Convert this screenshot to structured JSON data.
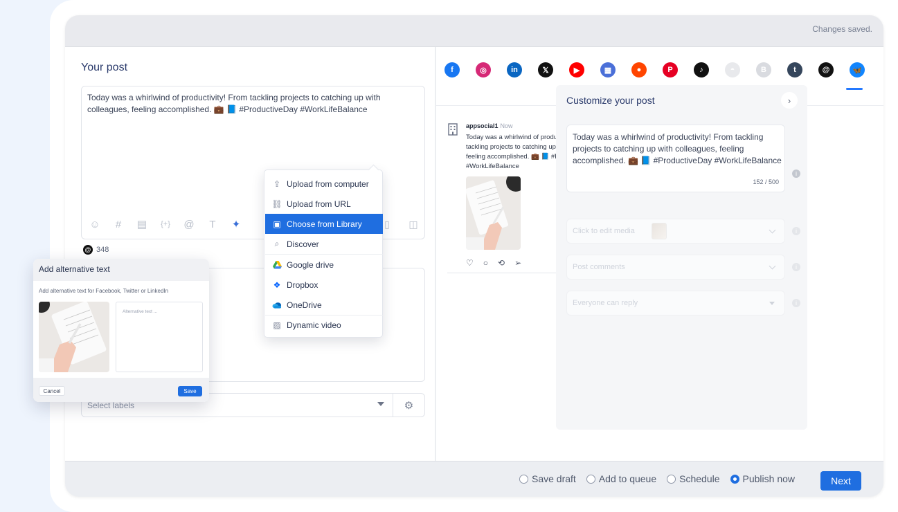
{
  "status": {
    "saved_text": "Changes saved."
  },
  "composer": {
    "title": "Your post",
    "text": "Today was a whirlwind of productivity! From tackling projects to catching up with colleagues, feeling accomplished. 💼 📘 #ProductiveDay #WorkLifeBalance",
    "char_count": "348",
    "labels_placeholder": "Select labels",
    "toolbar_icons": [
      "emoji-icon",
      "hashtag-icon",
      "list-icon",
      "variables-icon",
      "mention-icon",
      "text-format-icon",
      "magic-wand-icon",
      "file-icon",
      "gallery-icon"
    ]
  },
  "media_menu": {
    "items": [
      {
        "label": "Upload from computer",
        "icon": "upload-icon"
      },
      {
        "label": "Upload from URL",
        "icon": "link-icon"
      },
      {
        "label": "Choose from Library",
        "icon": "image-icon",
        "selected": true
      },
      {
        "label": "Discover",
        "icon": "search-icon"
      },
      {
        "label": "Google drive",
        "icon": "google-drive-icon"
      },
      {
        "label": "Dropbox",
        "icon": "dropbox-icon"
      },
      {
        "label": "OneDrive",
        "icon": "onedrive-icon"
      },
      {
        "label": "Dynamic video",
        "icon": "video-icon"
      }
    ]
  },
  "alt_modal": {
    "title": "Add alternative text",
    "subtitle": "Add alternative text for Facebook, Twitter or LinkedIn",
    "placeholder": "Alternative text ...",
    "cancel": "Cancel",
    "save": "Save"
  },
  "networks": [
    {
      "name": "facebook-icon",
      "color": "#1877f2",
      "glyph": "f"
    },
    {
      "name": "instagram-icon",
      "color": "#d62976",
      "glyph": "◎"
    },
    {
      "name": "linkedin-icon",
      "color": "#0a66c2",
      "glyph": "in"
    },
    {
      "name": "x-icon",
      "color": "#111111",
      "glyph": "𝕏"
    },
    {
      "name": "youtube-icon",
      "color": "#ff0000",
      "glyph": "▶"
    },
    {
      "name": "google-business-icon",
      "color": "#4a6fd8",
      "glyph": "▦"
    },
    {
      "name": "reddit-icon",
      "color": "#ff4500",
      "glyph": "●"
    },
    {
      "name": "pinterest-icon",
      "color": "#e60023",
      "glyph": "P"
    },
    {
      "name": "tiktok-icon",
      "color": "#111111",
      "glyph": "♪"
    },
    {
      "name": "snapchat-icon",
      "color": "#e8e9ec",
      "glyph": "◓"
    },
    {
      "name": "blogger-icon",
      "color": "#d9dbe0",
      "glyph": "B"
    },
    {
      "name": "tumblr-icon",
      "color": "#35465c",
      "glyph": "t"
    },
    {
      "name": "threads-icon",
      "color": "#111111",
      "glyph": "@"
    },
    {
      "name": "bluesky-icon",
      "color": "#1185fe",
      "glyph": "🦋"
    }
  ],
  "preview": {
    "account": "appsocial1",
    "time": "Now",
    "text": "Today was a whirlwind of productivity! From tackling projects to catching up with colleagues, feeling accomplished. 💼 📘 #ProductiveDay #WorkLifeBalance"
  },
  "customize": {
    "title": "Customize your post",
    "text": "Today was a whirlwind of productivity! From tackling projects to catching up with colleagues, feeling accomplished. 💼 📘 #ProductiveDay #WorkLifeBalance",
    "count": "152 / 500",
    "media_field": "Click to edit media",
    "comments_field": "Post comments",
    "reply_field": "Everyone can reply"
  },
  "footer": {
    "options": [
      "Save draft",
      "Add to queue",
      "Schedule",
      "Publish now"
    ],
    "selected_option": "Publish now",
    "next_label": "Next"
  },
  "colors": {
    "accent": "#1f6ee0",
    "active_tab": "#2479ff"
  }
}
